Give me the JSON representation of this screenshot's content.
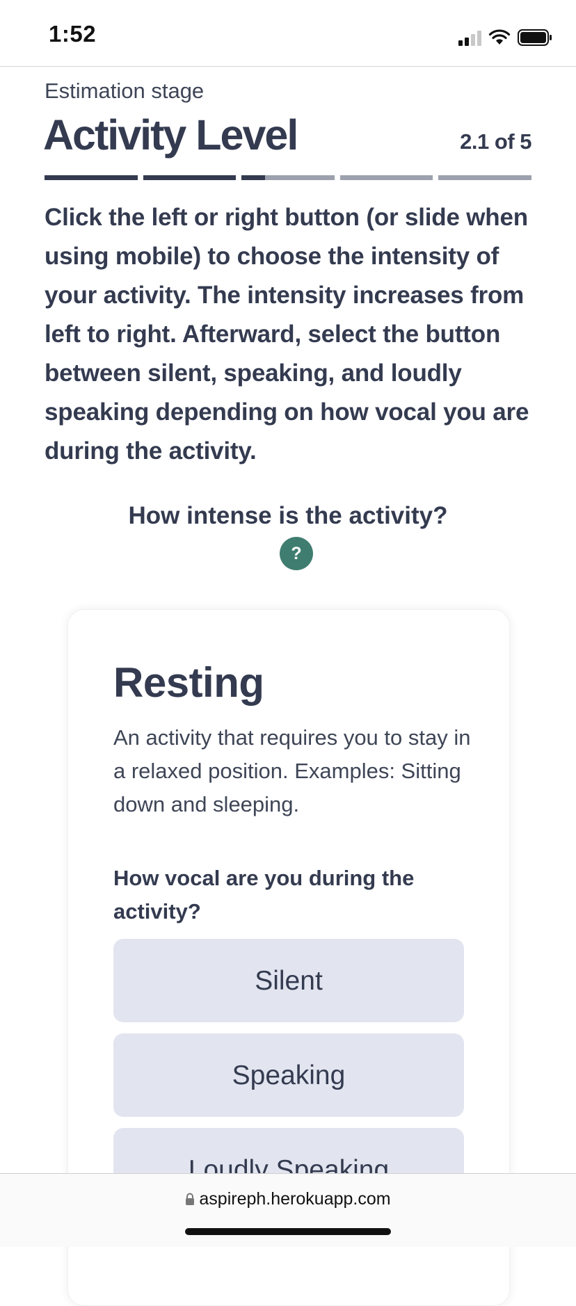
{
  "status_bar": {
    "time": "1:52",
    "icons": [
      "signal-icon",
      "wifi-icon",
      "battery-icon"
    ]
  },
  "header": {
    "eyebrow": "Estimation stage",
    "title": "Activity Level",
    "step_counter": "2.1 of 5"
  },
  "progress": {
    "total_steps": 5,
    "completed": 2,
    "current_step_fraction": 0.25
  },
  "instructions": "Click the left or right button (or slide when using mobile) to choose the intensity of your activity. The intensity increases from left to right. Afterward, select the button between silent, speaking, and loudly speaking depending on how vocal you are during the activity.",
  "intensity": {
    "question": "How intense is the activity?",
    "help_label": "?"
  },
  "card": {
    "title": "Resting",
    "description": "An activity that requires you to stay in a relaxed position. Examples: Sitting down and sleeping.",
    "vocal_question": "How vocal are you during the activity?",
    "options": [
      {
        "label": "Silent"
      },
      {
        "label": "Speaking"
      },
      {
        "label": "Loudly Speaking"
      }
    ]
  },
  "browser": {
    "url": "aspireph.herokuapp.com"
  },
  "colors": {
    "text": "#343b50",
    "accent": "#3f7d70",
    "option_bg": "#e2e5ef",
    "progress_inactive": "#9ca1ad"
  }
}
